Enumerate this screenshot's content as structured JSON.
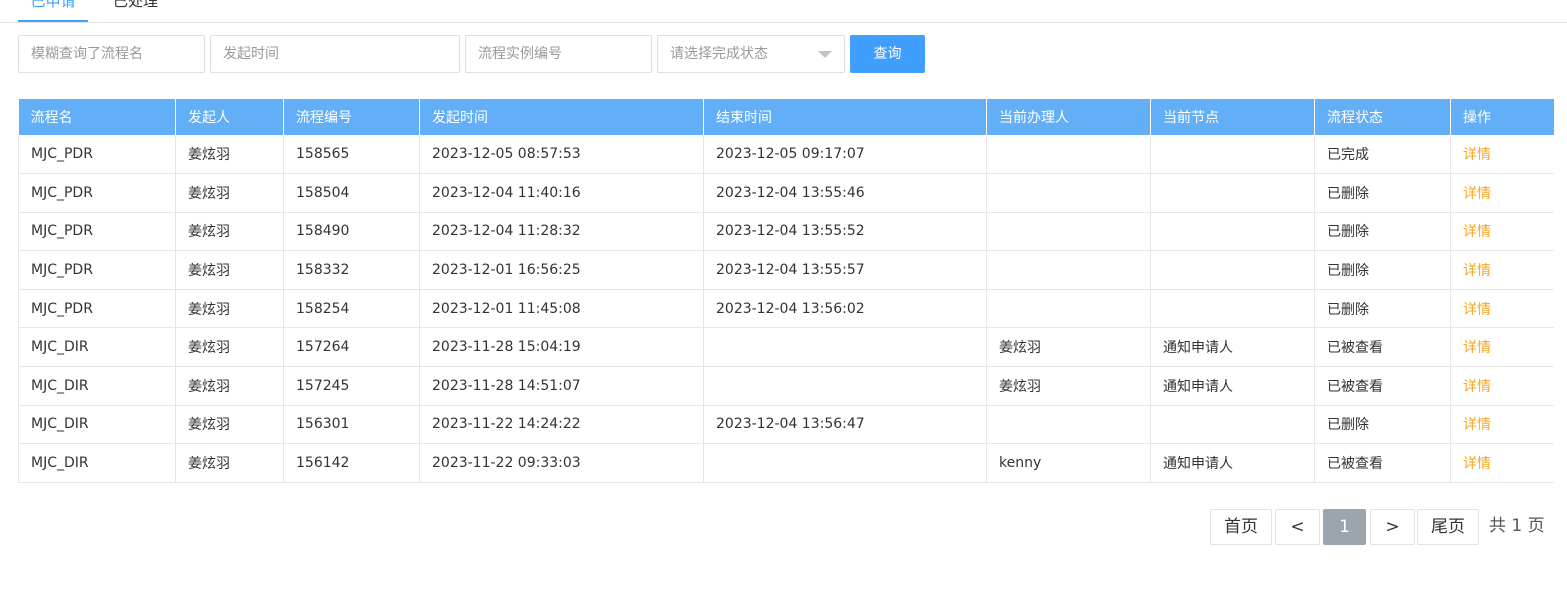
{
  "tabs": [
    {
      "label": "已申请"
    },
    {
      "label": "已处理"
    }
  ],
  "filters": {
    "process_name_placeholder": "模糊查询了流程名",
    "start_time_placeholder": "发起时间",
    "instance_no_placeholder": "流程实例编号",
    "status_placeholder": "请选择完成状态",
    "query_label": "查询"
  },
  "table": {
    "headers": [
      "流程名",
      "发起人",
      "流程编号",
      "发起时间",
      "结束时间",
      "当前办理人",
      "当前节点",
      "流程状态",
      "操作"
    ],
    "rows": [
      {
        "name": "MJC_PDR",
        "initiator": "姜炫羽",
        "id": "158565",
        "start": "2023-12-05 08:57:53",
        "end": "2023-12-05 09:17:07",
        "handler": "",
        "node": "",
        "status": "已完成",
        "action": "详情"
      },
      {
        "name": "MJC_PDR",
        "initiator": "姜炫羽",
        "id": "158504",
        "start": "2023-12-04 11:40:16",
        "end": "2023-12-04 13:55:46",
        "handler": "",
        "node": "",
        "status": "已删除",
        "action": "详情"
      },
      {
        "name": "MJC_PDR",
        "initiator": "姜炫羽",
        "id": "158490",
        "start": "2023-12-04 11:28:32",
        "end": "2023-12-04 13:55:52",
        "handler": "",
        "node": "",
        "status": "已删除",
        "action": "详情"
      },
      {
        "name": "MJC_PDR",
        "initiator": "姜炫羽",
        "id": "158332",
        "start": "2023-12-01 16:56:25",
        "end": "2023-12-04 13:55:57",
        "handler": "",
        "node": "",
        "status": "已删除",
        "action": "详情"
      },
      {
        "name": "MJC_PDR",
        "initiator": "姜炫羽",
        "id": "158254",
        "start": "2023-12-01 11:45:08",
        "end": "2023-12-04 13:56:02",
        "handler": "",
        "node": "",
        "status": "已删除",
        "action": "详情"
      },
      {
        "name": "MJC_DIR",
        "initiator": "姜炫羽",
        "id": "157264",
        "start": "2023-11-28 15:04:19",
        "end": "",
        "handler": "姜炫羽",
        "node": "通知申请人",
        "status": "已被查看",
        "action": "详情"
      },
      {
        "name": "MJC_DIR",
        "initiator": "姜炫羽",
        "id": "157245",
        "start": "2023-11-28 14:51:07",
        "end": "",
        "handler": "姜炫羽",
        "node": "通知申请人",
        "status": "已被查看",
        "action": "详情"
      },
      {
        "name": "MJC_DIR",
        "initiator": "姜炫羽",
        "id": "156301",
        "start": "2023-11-22 14:24:22",
        "end": "2023-12-04 13:56:47",
        "handler": "",
        "node": "",
        "status": "已删除",
        "action": "详情"
      },
      {
        "name": "MJC_DIR",
        "initiator": "姜炫羽",
        "id": "156142",
        "start": "2023-11-22 09:33:03",
        "end": "",
        "handler": "kenny",
        "node": "通知申请人",
        "status": "已被查看",
        "action": "详情"
      }
    ]
  },
  "pagination": {
    "first": "首页",
    "prev": "<",
    "current": "1",
    "next": ">",
    "last": "尾页",
    "total": "共 1 页"
  },
  "colors": {
    "accent": "#409eff",
    "header_bg": "#62aff8",
    "link": "#f5a623",
    "current_page_bg": "#9aa5ad"
  }
}
